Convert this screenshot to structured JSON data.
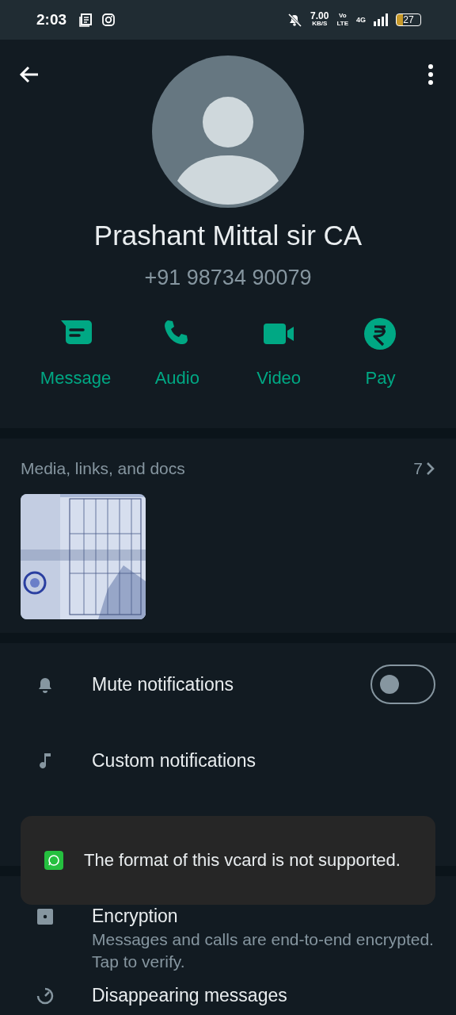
{
  "status_bar": {
    "time": "2:03",
    "speed": "7.00",
    "speed_unit": "KB/S",
    "volte_top": "Vo",
    "volte_bottom": "LTE",
    "network": "4G",
    "battery": "27"
  },
  "contact": {
    "name": "Prashant Mittal sir CA",
    "phone": "+91 98734 90079"
  },
  "actions": [
    {
      "kind": "message",
      "label": "Message"
    },
    {
      "kind": "audio",
      "label": "Audio"
    },
    {
      "kind": "video",
      "label": "Video"
    },
    {
      "kind": "pay",
      "label": "Pay"
    }
  ],
  "media": {
    "title": "Media, links, and docs",
    "count": "7"
  },
  "settings_groups": [
    [
      {
        "kind": "toggle",
        "label": "Mute notifications",
        "checked": false
      },
      {
        "kind": "plain",
        "label": "Custom notifications"
      }
    ],
    [
      {
        "kind": "detail",
        "label": "Encryption",
        "detail": "Messages and calls are end-to-end encrypted. Tap to verify."
      },
      {
        "kind": "plain",
        "label": "Disappearing messages"
      }
    ]
  ],
  "toast": {
    "message": "The format of this vcard is not supported."
  }
}
